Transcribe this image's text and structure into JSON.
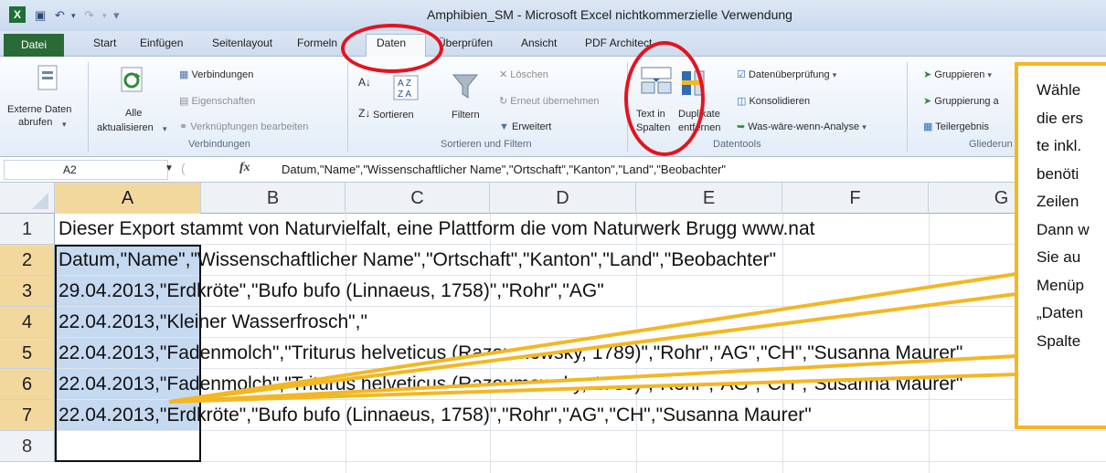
{
  "titlebar": {
    "app_icon": "X",
    "title": "Amphibien_SM  -  Microsoft Excel nichtkommerzielle Verwendung"
  },
  "tabs": [
    "Datei",
    "Start",
    "Einfügen",
    "Seitenlayout",
    "Formeln",
    "Daten",
    "Überprüfen",
    "Ansicht",
    "PDF Architect"
  ],
  "ribbon": {
    "externe": {
      "line1": "Externe Daten",
      "line2": "abrufen"
    },
    "alle": {
      "line1": "Alle",
      "line2": "aktualisieren"
    },
    "verbindungen": "Verbindungen",
    "eigenschaften": "Eigenschaften",
    "verknuepfungen": "Verknüpfungen bearbeiten",
    "group_verbindungen": "Verbindungen",
    "sortieren": "Sortieren",
    "filtern": "Filtern",
    "loeschen": "Löschen",
    "erneut": "Erneut übernehmen",
    "erweitert": "Erweitert",
    "group_sortieren": "Sortieren und Filtern",
    "text_spalten": {
      "line1": "Text in",
      "line2": "Spalten"
    },
    "duplikate": {
      "line1": "Duplikate",
      "line2": "entfernen"
    },
    "datenueberpruefung": "Datenüberprüfung",
    "konsolidieren": "Konsolidieren",
    "was_waere": "Was-wäre-wenn-Analyse",
    "group_datentools": "Datentools",
    "gruppieren": "Gruppieren",
    "gruppierung": "Gruppierung a",
    "teilergebnis": "Teilergebnis",
    "group_gliederung": "Gliederun"
  },
  "formula_bar": {
    "name_box": "A2",
    "fx": "fx",
    "formula": "Datum,\"Name\",\"Wissenschaftlicher Name\",\"Ortschaft\",\"Kanton\",\"Land\",\"Beobachter\""
  },
  "columns": [
    "A",
    "B",
    "C",
    "D",
    "E",
    "F",
    "G"
  ],
  "rows": [
    {
      "num": "1",
      "text": "Dieser Export stammt von Naturvielfalt, eine Plattform die vom Naturwerk Brugg www.nat"
    },
    {
      "num": "2",
      "text": "Datum,\"Name\",\"Wissenschaftlicher Name\",\"Ortschaft\",\"Kanton\",\"Land\",\"Beobachter\""
    },
    {
      "num": "3",
      "text": "29.04.2013,\"Erdkröte\",\"Bufo bufo (Linnaeus, 1758)\",\"Rohr\",\"AG\""
    },
    {
      "num": "4",
      "text": "22.04.2013,\"Kleiner Wasserfrosch\",\""
    },
    {
      "num": "5",
      "text": "22.04.2013,\"Fadenmolch\",\"Triturus helveticus (Razoumowsky, 1789)\",\"Rohr\",\"AG\",\"CH\",\"Susanna Maurer\""
    },
    {
      "num": "6",
      "text": "22.04.2013,\"Fadenmolch\",\"Triturus helveticus (Razoumowsky, 1789)\",\"Rohr\",\"AG\",\"CH\",\"Susanna Maurer\""
    },
    {
      "num": "7",
      "text": "22.04.2013,\"Erdkröte\",\"Bufo bufo (Linnaeus, 1758)\",\"Rohr\",\"AG\",\"CH\",\"Susanna Maurer\""
    },
    {
      "num": "8",
      "text": ""
    }
  ],
  "callout": {
    "lines": [
      "Wähle",
      "die ers",
      "te inkl.",
      "benöti",
      "Zeilen",
      "Dann w",
      "Sie au",
      "Menüp",
      "„Daten",
      "Spalte"
    ]
  },
  "colors": {
    "accent_red": "#e3141f",
    "callout_border": "#f3b724",
    "selection_fill": "#c5d9f1",
    "header_selected": "#f3d89e",
    "excel_green": "#2a6a36"
  }
}
